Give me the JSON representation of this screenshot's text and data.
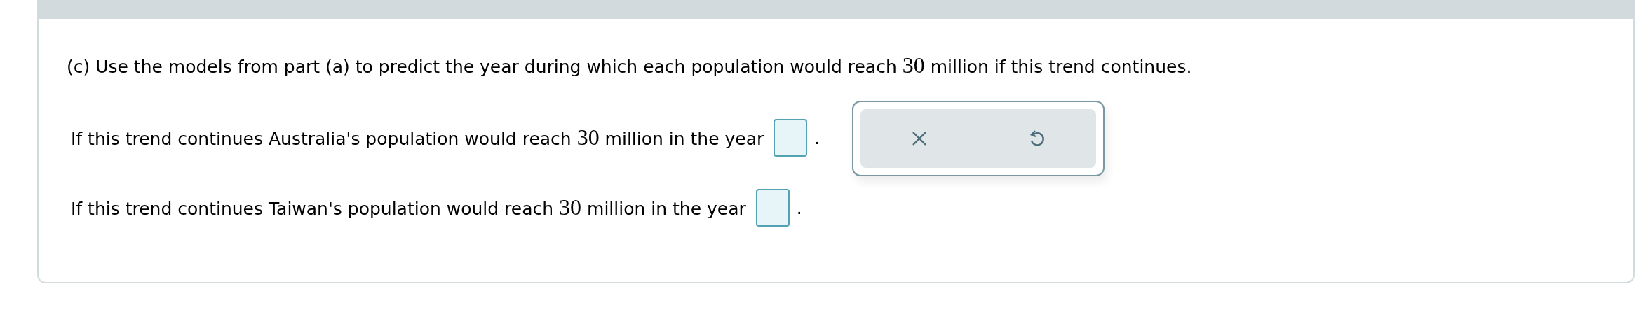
{
  "question": {
    "before": "(c) Use the models from part (a) to predict the year during which each population would reach ",
    "math": "30",
    "after": " million if this trend continues."
  },
  "answers": [
    {
      "before": "If this trend continues Australia's population would reach ",
      "math": "30",
      "after": " million in the year",
      "end": "."
    },
    {
      "before": "If this trend continues Taiwan's population would reach ",
      "math": "30",
      "after": " million in the year",
      "end": "."
    }
  ],
  "toolbar": {
    "buttons": [
      {
        "kind": "clear"
      },
      {
        "kind": "undo"
      }
    ]
  }
}
